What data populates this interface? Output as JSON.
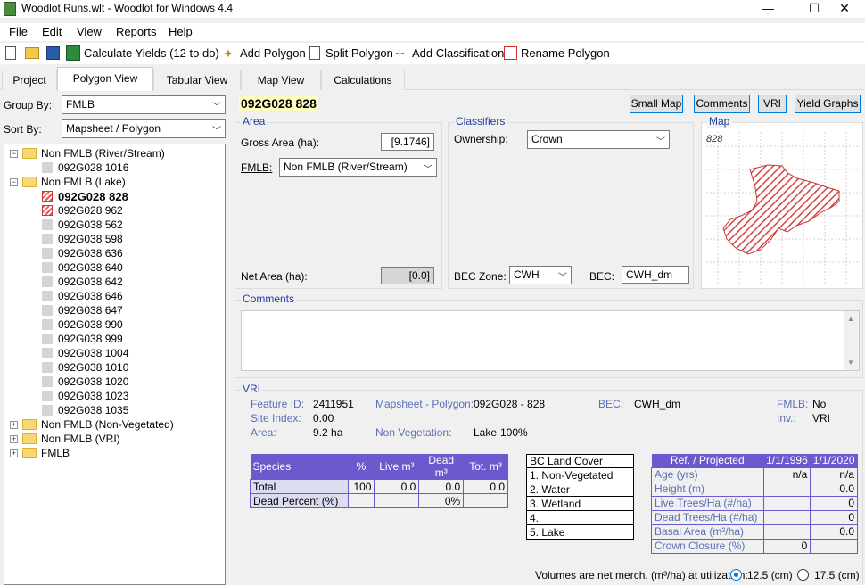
{
  "window": {
    "title": "Woodlot Runs.wlt - Woodlot for Windows 4.4",
    "min": "—",
    "max": "☐",
    "close": "✕"
  },
  "menu": [
    "File",
    "Edit",
    "View",
    "Reports",
    "Help"
  ],
  "toolbar": {
    "calc": "Calculate Yields (12 to do)",
    "add": "Add Polygon",
    "split": "Split Polygon",
    "addclass": "Add Classification",
    "rename": "Rename Polygon"
  },
  "tabs": [
    "Project",
    "Polygon View",
    "Tabular View",
    "Map View",
    "Calculations"
  ],
  "left": {
    "group_by_label": "Group By:",
    "group_by": "FMLB",
    "sort_by_label": "Sort By:",
    "sort_by": "Mapsheet / Polygon"
  },
  "tree": {
    "river": "Non FMLB (River/Stream)",
    "river_items": [
      "092G028 1016"
    ],
    "lake": "Non FMLB (Lake)",
    "lake_items": [
      "092G028 828",
      "092G028 962",
      "092G038 562",
      "092G038 598",
      "092G038 636",
      "092G038 640",
      "092G038 642",
      "092G038 646",
      "092G038 647",
      "092G038 990",
      "092G038 999",
      "092G038 1004",
      "092G038 1010",
      "092G038 1020",
      "092G038 1023",
      "092G038 1035"
    ],
    "nonveg": "Non FMLB (Non-Vegetated)",
    "vri": "Non FMLB (VRI)",
    "fmlb": "FMLB"
  },
  "polygon": {
    "title": "092G028 828"
  },
  "buttons": {
    "small_map": "Small Map",
    "comments": "Comments",
    "vri": "VRI",
    "yield": "Yield Graphs"
  },
  "area": {
    "title": "Area",
    "gross_label": "Gross Area (ha):",
    "gross": "[9.1746]",
    "fmlb_label": "FMLB:",
    "fmlb": "Non FMLB (River/Stream)",
    "net_label": "Net Area (ha):",
    "net": "[0.0]"
  },
  "classifiers": {
    "title": "Classifiers",
    "ownership_label": "Ownership:",
    "ownership": "Crown",
    "bec_zone_label": "BEC Zone:",
    "bec_zone": "CWH",
    "bec_label": "BEC:",
    "bec": "CWH_dm"
  },
  "map": {
    "title": "Map",
    "label": "828"
  },
  "comments": {
    "title": "Comments"
  },
  "vri": {
    "title": "VRI",
    "feature_label": "Feature ID:",
    "feature": "2411951",
    "mapsheet_label": "Mapsheet - Polygon:",
    "mapsheet": "092G028 - 828",
    "bec_label": "BEC:",
    "bec": "CWH_dm",
    "fmlb_label": "FMLB:",
    "fmlb": "No",
    "site_label": "Site Index:",
    "site": "0.00",
    "inv_label": "Inv.:",
    "inv": "VRI",
    "area_label": "Area:",
    "area": "9.2 ha",
    "nonveg_label": "Non Vegetation:",
    "nonveg": "Lake",
    "nonveg_pct": "100%"
  },
  "species": {
    "headers": [
      "Species",
      "%",
      "Live m³",
      "Dead m³",
      "Tot. m³"
    ],
    "rows": [
      [
        "Total",
        "100",
        "0.0",
        "0.0",
        "0.0"
      ],
      [
        "Dead Percent (%)",
        "",
        "",
        "0%",
        ""
      ]
    ]
  },
  "landcover": {
    "header": "BC Land Cover",
    "rows": [
      "1. Non-Vegetated",
      "2. Water",
      "3. Wetland",
      "4.",
      "5. Lake"
    ]
  },
  "refproj": {
    "headers": [
      "Ref. / Projected",
      "1/1/1996",
      "1/1/2020"
    ],
    "rows": [
      [
        "Age (yrs)",
        "n/a",
        "n/a"
      ],
      [
        "Height (m)",
        "",
        "0.0"
      ],
      [
        "Live Trees/Ha (#/ha)",
        "",
        "0"
      ],
      [
        "Dead Trees/Ha (#/ha)",
        "",
        "0"
      ],
      [
        "Basal Area (m²/ha)",
        "",
        "0.0"
      ],
      [
        "Crown Closure (%)",
        "0",
        ""
      ]
    ]
  },
  "footer": {
    "text": "Volumes are net merch. (m³/ha) at utilization:",
    "opt1": "12.5 (cm)",
    "opt2": "17.5 (cm)"
  }
}
